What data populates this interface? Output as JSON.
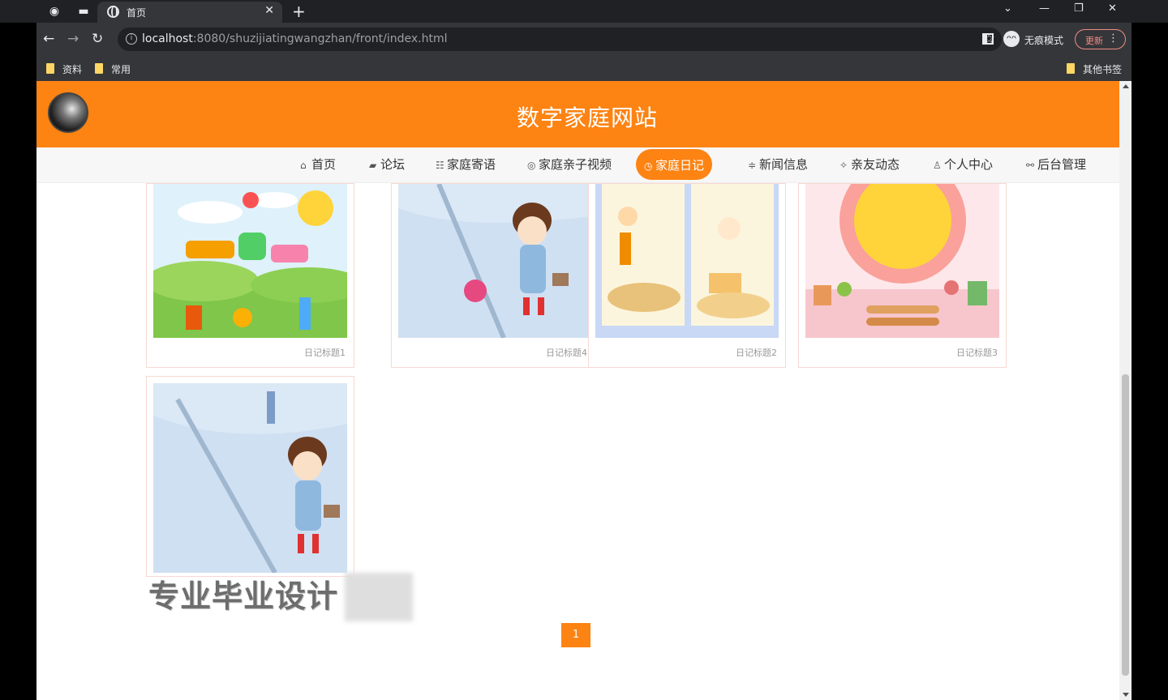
{
  "browser": {
    "tab_title": "首页",
    "url_host": "localhost",
    "url_rest": ":8080/shuzijiatingwangzhan/front/index.html",
    "incognito_label": "无痕模式",
    "update_label": "更新",
    "bookmarks": [
      "资料",
      "常用"
    ],
    "other_bookmarks": "其他书签"
  },
  "site": {
    "title": "数字家庭网站"
  },
  "nav": [
    {
      "label": "首页",
      "icon": "home-icon",
      "glyph": "⌂"
    },
    {
      "label": "论坛",
      "icon": "graduation-cap-icon",
      "glyph": "▰"
    },
    {
      "label": "家庭寄语",
      "icon": "message-icon",
      "glyph": "☷"
    },
    {
      "label": "家庭亲子视频",
      "icon": "video-icon",
      "glyph": "◎"
    },
    {
      "label": "家庭日记",
      "icon": "clock-icon",
      "glyph": "◷"
    },
    {
      "label": "新闻信息",
      "icon": "news-icon",
      "glyph": "≑"
    },
    {
      "label": "亲友动态",
      "icon": "spark-icon",
      "glyph": "✧"
    },
    {
      "label": "个人中心",
      "icon": "user-icon",
      "glyph": "♙"
    },
    {
      "label": "后台管理",
      "icon": "link-icon",
      "glyph": "⚯"
    }
  ],
  "diaries": [
    {
      "caption": "日记标题1"
    },
    {
      "caption": "日记标题4"
    },
    {
      "caption": "日记标题2"
    },
    {
      "caption": "日记标题3"
    },
    {
      "caption": ""
    }
  ],
  "pagination": {
    "current": "1"
  },
  "watermark": "专业毕业设计"
}
